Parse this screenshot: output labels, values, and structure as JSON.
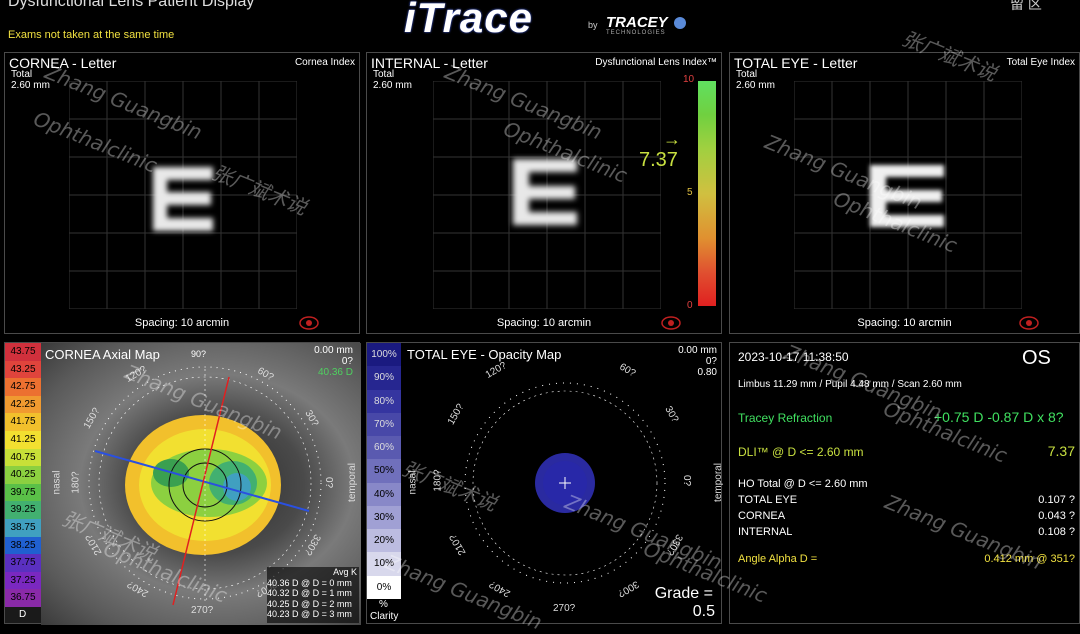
{
  "header": {
    "title": "Dysfunctional Lens Patient Display",
    "logo": "iTrace",
    "by": "by",
    "brand": "TRACEY",
    "brand_sub": "TECHNOLOGIES",
    "right_text": "留 区",
    "warning": "Exams not taken at the same time"
  },
  "panels": {
    "cornea_letter": {
      "title": "CORNEA - Letter",
      "corner": "Cornea Index",
      "sub1": "Total",
      "sub2": "2.60 mm",
      "spacing": "Spacing:  10 arcmin"
    },
    "internal_letter": {
      "title": "INTERNAL - Letter",
      "corner": "Dysfunctional Lens Index™",
      "sub1": "Total",
      "sub2": "2.60 mm",
      "spacing": "Spacing:  10 arcmin"
    },
    "total_letter": {
      "title": "TOTAL EYE - Letter",
      "corner": "Total Eye Index",
      "sub1": "Total",
      "sub2": "2.60 mm",
      "spacing": "Spacing:  10 arcmin"
    }
  },
  "dli_scale": {
    "top": "10",
    "mid": "5",
    "bottom": "0",
    "value": "7.37",
    "arrow": "→"
  },
  "axial_map": {
    "title": "CORNEA  Axial Map",
    "angle": "90?",
    "mm": "0.00 mm",
    "deg": "0?",
    "cursor": "40.36 D",
    "nasal": "nasal",
    "temporal": "temporal",
    "unit": "D",
    "scale": [
      "43.75",
      "43.25",
      "42.75",
      "42.25",
      "41.75",
      "41.25",
      "40.75",
      "40.25",
      "39.75",
      "39.25",
      "38.75",
      "38.25",
      "37.75",
      "37.25",
      "36.75"
    ],
    "scale_colors": [
      "#d0303c",
      "#e0443c",
      "#ec7030",
      "#f09a30",
      "#f2c02c",
      "#f2e030",
      "#c8e038",
      "#8cd040",
      "#5ac048",
      "#42b070",
      "#40a0c0",
      "#2060d0",
      "#5a30c0",
      "#7a28c0",
      "#8a2aa8"
    ],
    "avg_label": "Avg K",
    "avg": [
      "40.36 D @ D = 0 mm",
      "40.32 D @ D = 1 mm",
      "40.25 D @ D = 2 mm",
      "40.23 D @ D = 3 mm"
    ],
    "ticks": [
      "120?",
      "60?",
      "150?",
      "30?",
      "180?",
      "0?",
      "210?",
      "330?",
      "240?",
      "300?",
      "270?"
    ]
  },
  "opacity_map": {
    "title": "TOTAL EYE - Opacity Map",
    "mm": "0.00 mm",
    "deg": "0?",
    "val": "0.80",
    "nasal": "nasal",
    "temporal": "temporal",
    "scale": [
      "100%",
      "90%",
      "80%",
      "70%",
      "60%",
      "50%",
      "40%",
      "30%",
      "20%",
      "10%",
      "0%"
    ],
    "scale_colors": [
      "#1a1a80",
      "#262690",
      "#3535a0",
      "#4848a8",
      "#5a5ab0",
      "#7070bc",
      "#8888c8",
      "#a0a0d4",
      "#bcbce0",
      "#d8d8ec",
      "#ffffff"
    ],
    "footer": "%",
    "clarity": "Clarity",
    "grade_label": "Grade =",
    "grade_value": "0.5",
    "ticks": [
      "120?",
      "60?",
      "150?",
      "30?",
      "180?",
      "0?",
      "210?",
      "330?",
      "240?",
      "300?",
      "270?"
    ]
  },
  "info": {
    "datetime": "2023-10-17   11:38:50",
    "eye": "OS",
    "limbus": "Limbus 11.29 mm  / Pupil 4.48 mm  / Scan 2.60 mm",
    "refraction_label": "Tracey Refraction",
    "refraction_value": "+0.75 D -0.87 D x 8?",
    "dli_label": "DLI™ @ D <= 2.60 mm",
    "dli_value": "7.37",
    "ho_label": "HO Total @ D <= 2.60 mm",
    "ho_rows": [
      {
        "label": "TOTAL EYE",
        "value": "0.107 ?"
      },
      {
        "label": "CORNEA",
        "value": "0.043 ?"
      },
      {
        "label": "INTERNAL",
        "value": "0.108 ?"
      }
    ],
    "angle_label": "Angle Alpha  D =",
    "angle_value": "0.412 mm @ 351?"
  },
  "watermark": {
    "name": "Zhang  Guangbin",
    "clinic": "Ophthalclinic",
    "cn": "张广斌术说"
  },
  "colors": {
    "yellow": "#f0e040",
    "green": "#40e060",
    "dli_green": "#c8e040",
    "panel_border": "#4a4a4a"
  }
}
